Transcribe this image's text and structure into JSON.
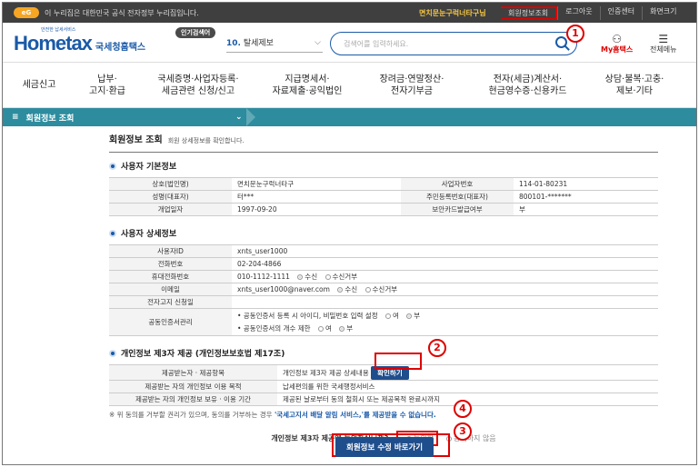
{
  "topbar": {
    "badge": "eG",
    "message": "이 누리집은 대한민국 공식 전자정부 누리집입니다.",
    "user": "면치문눈구럭너타구님",
    "links": [
      "회원정보조회",
      "로그아웃",
      "인증센터",
      "화면크기"
    ]
  },
  "header": {
    "logo_main": "Hometax",
    "logo_sub": "국세청홈택스",
    "logo_small": "안전한 납세서비스",
    "popular_label": "인기검색어",
    "popular_num": "10.",
    "popular_value": "탈세제보",
    "search_placeholder": "검색어를 입력하세요.",
    "myhome": "My홈택스",
    "allmenu": "전체메뉴"
  },
  "nav": [
    "세금신고",
    "납부·\n고지·환급",
    "국세증명·사업자등록·\n세금관련 신청/신고",
    "지급명세서·\n자료제출·공익법인",
    "장려금·연말정산·\n전자기부금",
    "전자(세금)계산서·\n현금영수증·신용카드",
    "상담·불복·고충·\n제보·기타"
  ],
  "section_bar": "회원정보 조회",
  "page": {
    "title": "회원정보 조회",
    "desc": "회원 상세정보를 확인합니다.",
    "basic_title": "사용자 기본정보",
    "basic": [
      [
        "상호(법인명)",
        "면치문눈구럭너타구",
        "사업자번호",
        "114-01-80231"
      ],
      [
        "성명(대표자)",
        "터***",
        "주민등록번호(대표자)",
        "800101-*******"
      ],
      [
        "개업일자",
        "1997-09-20",
        "보안카드발급여부",
        "부"
      ]
    ],
    "detail_title": "사용자 상세정보",
    "detail": {
      "id_label": "사용자ID",
      "id_value": "xnts_user1000",
      "phone_label": "전화번호",
      "phone_value": "02-204-4866",
      "mobile_label": "휴대전화번호",
      "mobile_value": "010-1112-1111",
      "mobile_opt1": "수신",
      "mobile_opt2": "수신거부",
      "email_label": "이메일",
      "email_value": "xnts_user1000@naver.com",
      "email_opt1": "수신",
      "email_opt2": "수신거부",
      "ebill_label": "전자고지 신청일",
      "ebill_value": "",
      "cert_label": "공동인증서관리",
      "cert_line1": "• 공동인증서 등록 시 아이디, 비밀번호 입력 설정",
      "cert_line2": "• 공동인증서의 개수 제한",
      "opt_no": "여",
      "opt_yes": "부"
    },
    "privacy_title": "개인정보 제3자 제공 (개인정보보호법 제17조)",
    "privacy": [
      [
        "제공받는자 · 제공항목",
        "개인정보 제3자 제공 상세내용"
      ],
      [
        "제공받는 자의 개인정보 이용 목적",
        "납세편의를 위한 국세행정서비스"
      ],
      [
        "제공받는 자의 개인정보 보유 · 이용 기간",
        "제공된 날로부터 동의 철회시 또는 제공목적 완료시까지"
      ]
    ],
    "confirm_btn": "확인하기",
    "note_prefix": "※ 위 동의를 거부할 권리가 있으며, 동의를 거부하는 경우 ",
    "note_bold": "'국세고지서 배달 알림 서비스,'를 제공받을 수 없습니다.",
    "agree_question": "개인정보 제3자 제공에 동의하십니까?",
    "agree_yes": "동의함",
    "agree_no": "동의하지 않음",
    "update_btn": "회원정보 수정 바로가기"
  },
  "markers": [
    "1",
    "2",
    "3",
    "4"
  ]
}
